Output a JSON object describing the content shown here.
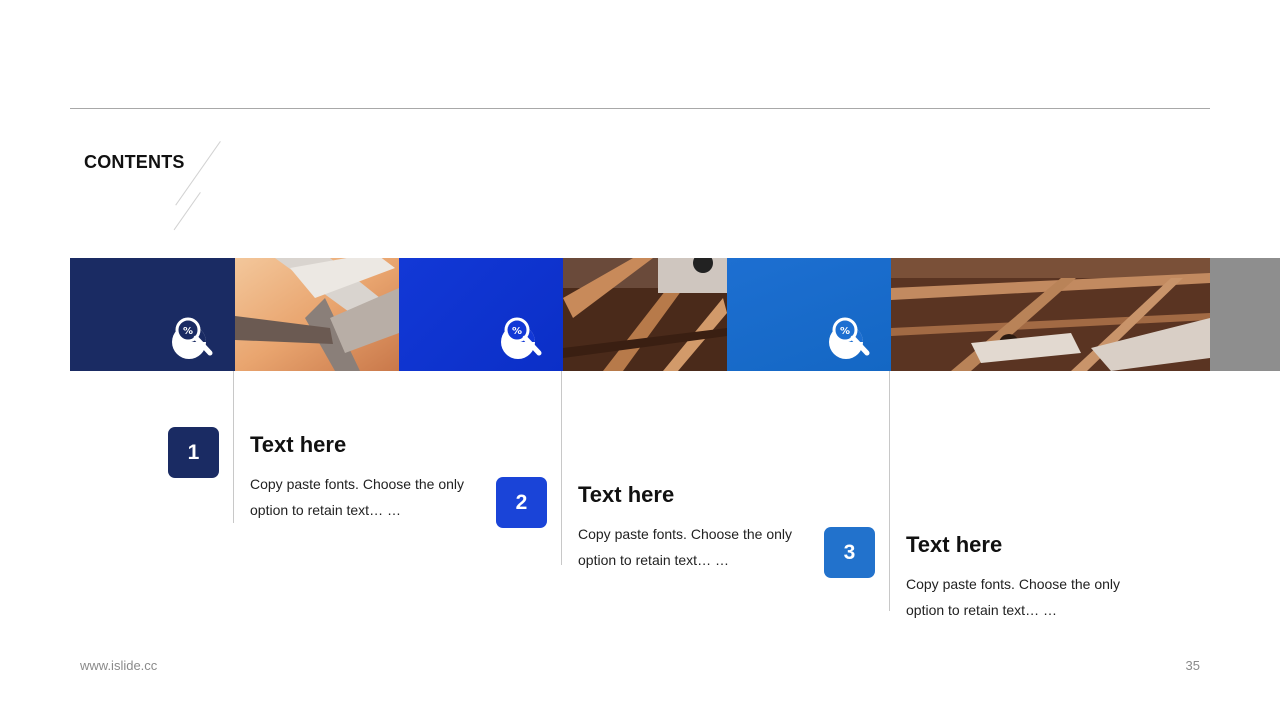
{
  "header": {
    "title": "CONTENTS"
  },
  "items": [
    {
      "number": "1",
      "title": "Text here",
      "text": "Copy paste fonts. Choose the only option to retain text… …"
    },
    {
      "number": "2",
      "title": "Text here",
      "text": "Copy paste fonts. Choose the only option to retain text… …"
    },
    {
      "number": "3",
      "title": "Text here",
      "text": "Copy paste fonts. Choose the only option to retain text… …"
    }
  ],
  "icons": {
    "band": "pie-chart-magnifier-icon"
  },
  "colors": {
    "navy": "#1a2b63",
    "royal_blue": "#1238d6",
    "sky_blue": "#1d6fd1",
    "grey": "#8e8e8e"
  },
  "footer": {
    "url": "www.islide.cc",
    "page_number": "35"
  }
}
